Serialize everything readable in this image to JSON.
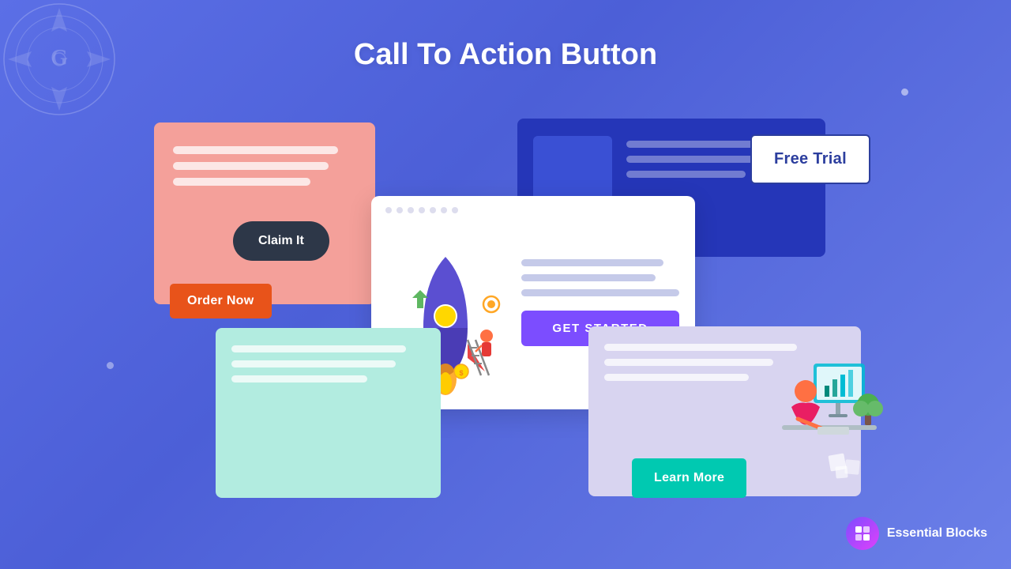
{
  "page": {
    "title": "Call To Action Button",
    "background_gradient": "135deg, #5b6fe6 0%, #4c5fd7 40%, #6b7fe8 100%"
  },
  "buttons": {
    "order_now": "Order Now",
    "free_trial": "Free Trial",
    "get_started": "GET STARTED",
    "claim_it": "Claim It",
    "learn_more": "Learn More"
  },
  "branding": {
    "name": "Essential Blocks",
    "icon": "⊞"
  }
}
